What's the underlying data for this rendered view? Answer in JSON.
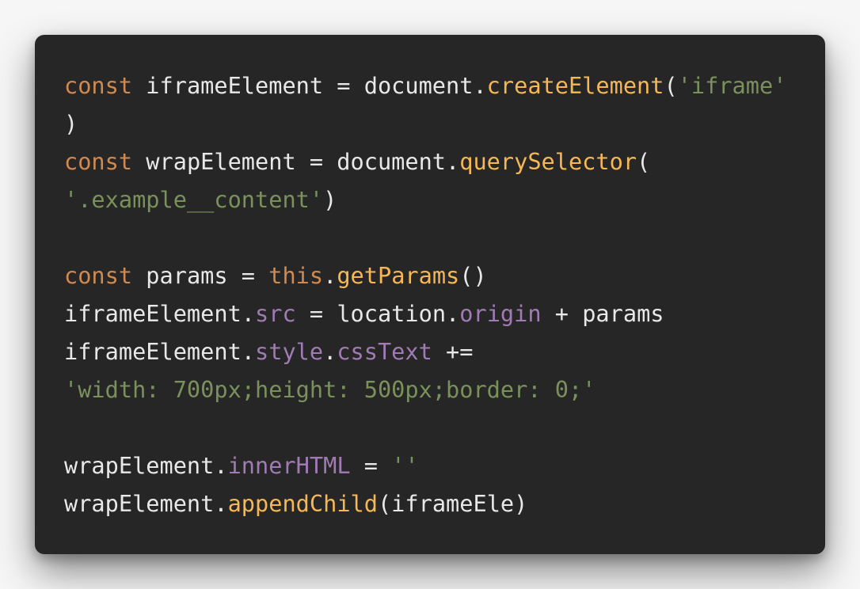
{
  "colors": {
    "background": "#262626",
    "page": "#f6f6f6",
    "keyword": "#d08a4f",
    "identifier": "#e8e8e8",
    "function": "#f6b855",
    "string": "#7a915c",
    "property": "#a07bb4"
  },
  "code": {
    "lines": [
      [
        {
          "t": "const",
          "k": "kw"
        },
        {
          "t": " iframeElement = document.",
          "k": "id"
        },
        {
          "t": "createElement",
          "k": "fn"
        },
        {
          "t": "(",
          "k": "id"
        },
        {
          "t": "'iframe'",
          "k": "str"
        }
      ],
      [
        {
          "t": ")",
          "k": "id"
        }
      ],
      [
        {
          "t": "const",
          "k": "kw"
        },
        {
          "t": " wrapElement = document.",
          "k": "id"
        },
        {
          "t": "querySelector",
          "k": "fn"
        },
        {
          "t": "(",
          "k": "id"
        }
      ],
      [
        {
          "t": "'.example__content'",
          "k": "str"
        },
        {
          "t": ")",
          "k": "id"
        }
      ],
      [],
      [
        {
          "t": "const",
          "k": "kw"
        },
        {
          "t": " params = ",
          "k": "id"
        },
        {
          "t": "this",
          "k": "kw"
        },
        {
          "t": ".",
          "k": "id"
        },
        {
          "t": "getParams",
          "k": "fn"
        },
        {
          "t": "()",
          "k": "id"
        }
      ],
      [
        {
          "t": "iframeElement.",
          "k": "id"
        },
        {
          "t": "src",
          "k": "prop"
        },
        {
          "t": " = location.",
          "k": "id"
        },
        {
          "t": "origin",
          "k": "prop"
        },
        {
          "t": " + params",
          "k": "id"
        }
      ],
      [
        {
          "t": "iframeElement.",
          "k": "id"
        },
        {
          "t": "style",
          "k": "prop"
        },
        {
          "t": ".",
          "k": "id"
        },
        {
          "t": "cssText",
          "k": "prop"
        },
        {
          "t": " +=",
          "k": "id"
        }
      ],
      [
        {
          "t": "'width: 700px;height: 500px;border: 0;'",
          "k": "str"
        }
      ],
      [],
      [
        {
          "t": "wrapElement.",
          "k": "id"
        },
        {
          "t": "innerHTML",
          "k": "prop"
        },
        {
          "t": " = ",
          "k": "id"
        },
        {
          "t": "''",
          "k": "str"
        }
      ],
      [
        {
          "t": "wrapElement.",
          "k": "id"
        },
        {
          "t": "appendChild",
          "k": "fn"
        },
        {
          "t": "(iframeEle)",
          "k": "id"
        }
      ]
    ]
  }
}
